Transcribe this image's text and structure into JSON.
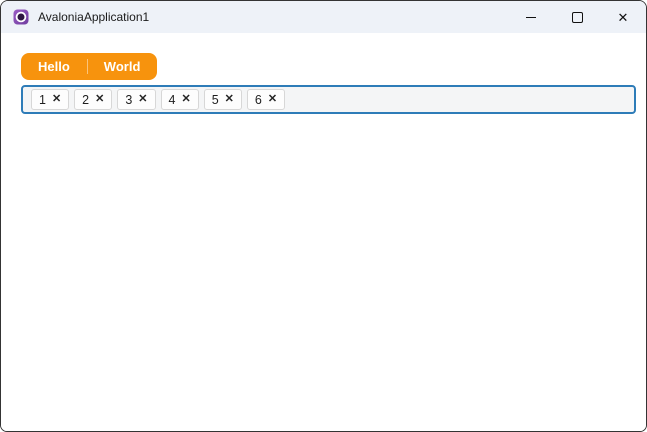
{
  "titlebar": {
    "app_title": "AvaloniaApplication1",
    "close_icon": "✕"
  },
  "tabs": [
    {
      "label": "Hello"
    },
    {
      "label": "World"
    }
  ],
  "tag_input": {
    "remove_icon": "✕",
    "chips": [
      {
        "label": "1"
      },
      {
        "label": "2"
      },
      {
        "label": "3"
      },
      {
        "label": "4"
      },
      {
        "label": "5"
      },
      {
        "label": "6"
      }
    ]
  },
  "colors": {
    "accent_orange": "#f7930d",
    "focus_border_blue": "#2e7cb8",
    "titlebar_bg": "#eef2f8",
    "window_border": "#343434",
    "chip_bg": "#fdfdfd",
    "chip_border": "#d7d7d7",
    "logo_purple": "#8a4cb8"
  }
}
